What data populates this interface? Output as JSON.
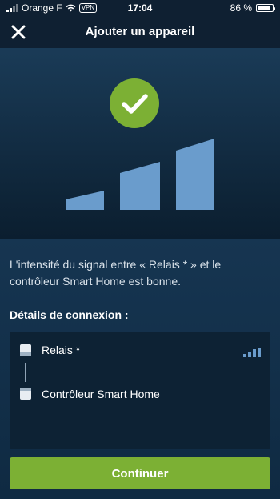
{
  "status_bar": {
    "carrier": "Orange F",
    "vpn": "VPN",
    "time": "17:04",
    "battery": "86 %",
    "battery_level": 0.86
  },
  "header": {
    "title": "Ajouter un appareil",
    "close_icon": "close-icon"
  },
  "hero": {
    "status_icon": "check-icon",
    "signal_strength_bars": 4,
    "signal_strength_filled": 4
  },
  "main": {
    "message": "L'intensité du signal entre « Relais * » et le contrôleur Smart Home est bonne.",
    "section_title": "Détails de connexion :",
    "devices": [
      {
        "label": "Relais *",
        "icon": "relay-device-icon"
      },
      {
        "label": "Contrôleur Smart Home",
        "icon": "controller-device-icon"
      }
    ],
    "continue_label": "Continuer"
  },
  "colors": {
    "accent_green": "#7cb034",
    "signal_blue": "#6a9ccc",
    "background": "#0d2236"
  }
}
